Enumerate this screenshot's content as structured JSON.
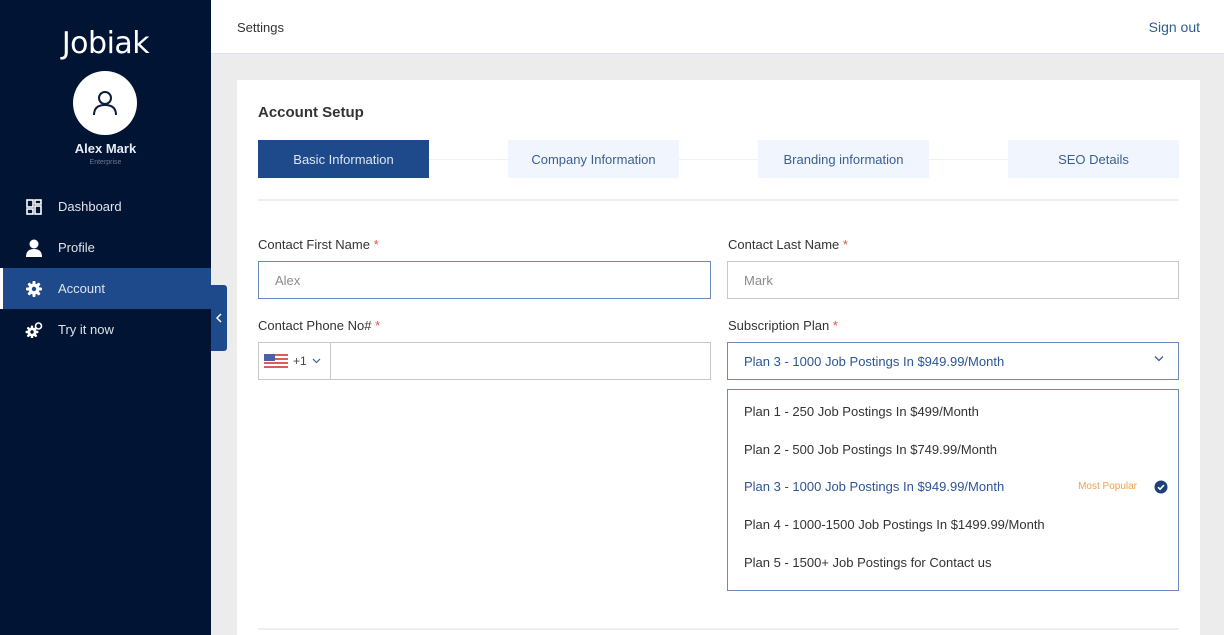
{
  "sidebar": {
    "logo": "Jobiak",
    "user": {
      "name": "Alex Mark",
      "role": "Enterprise"
    },
    "items": [
      {
        "label": "Dashboard",
        "icon": "dashboard-icon",
        "active": false
      },
      {
        "label": "Profile",
        "icon": "user-icon",
        "active": false
      },
      {
        "label": "Account",
        "icon": "gear-icon",
        "active": true
      },
      {
        "label": "Try it now",
        "icon": "gears-icon",
        "active": false
      }
    ]
  },
  "header": {
    "title": "Settings",
    "signout_label": "Sign out"
  },
  "card": {
    "title": "Account Setup",
    "steps": [
      {
        "label": "Basic Information",
        "active": true
      },
      {
        "label": "Company Information",
        "active": false
      },
      {
        "label": "Branding information",
        "active": false
      },
      {
        "label": "SEO Details",
        "active": false
      }
    ]
  },
  "form": {
    "first_name": {
      "label": "Contact First Name",
      "required": "*",
      "placeholder": "Alex"
    },
    "last_name": {
      "label": "Contact Last Name",
      "required": "*",
      "placeholder": "Mark"
    },
    "phone": {
      "label": "Contact Phone No#",
      "required": "*",
      "country_code": "+1",
      "country": "US",
      "value": ""
    },
    "plan": {
      "label": "Subscription Plan",
      "required": "*",
      "selected": "Plan 3 - 1000 Job Postings In $949.99/Month",
      "options": [
        {
          "label": "Plan 1 - 250 Job Postings In $499/Month"
        },
        {
          "label": "Plan 2 - 500 Job Postings In $749.99/Month"
        },
        {
          "label": "Plan 3 - 1000 Job Postings In $949.99/Month",
          "badge": "Most Popular",
          "selected": true
        },
        {
          "label": "Plan 4 - 1000-1500 Job Postings In $1499.99/Month"
        },
        {
          "label": "Plan 5 - 1500+ Job Postings for Contact us"
        }
      ]
    }
  },
  "colors": {
    "sidebar_bg": "#021433",
    "accent": "#1e4a8c",
    "badge": "#f0a050",
    "required": "#e2533f"
  }
}
